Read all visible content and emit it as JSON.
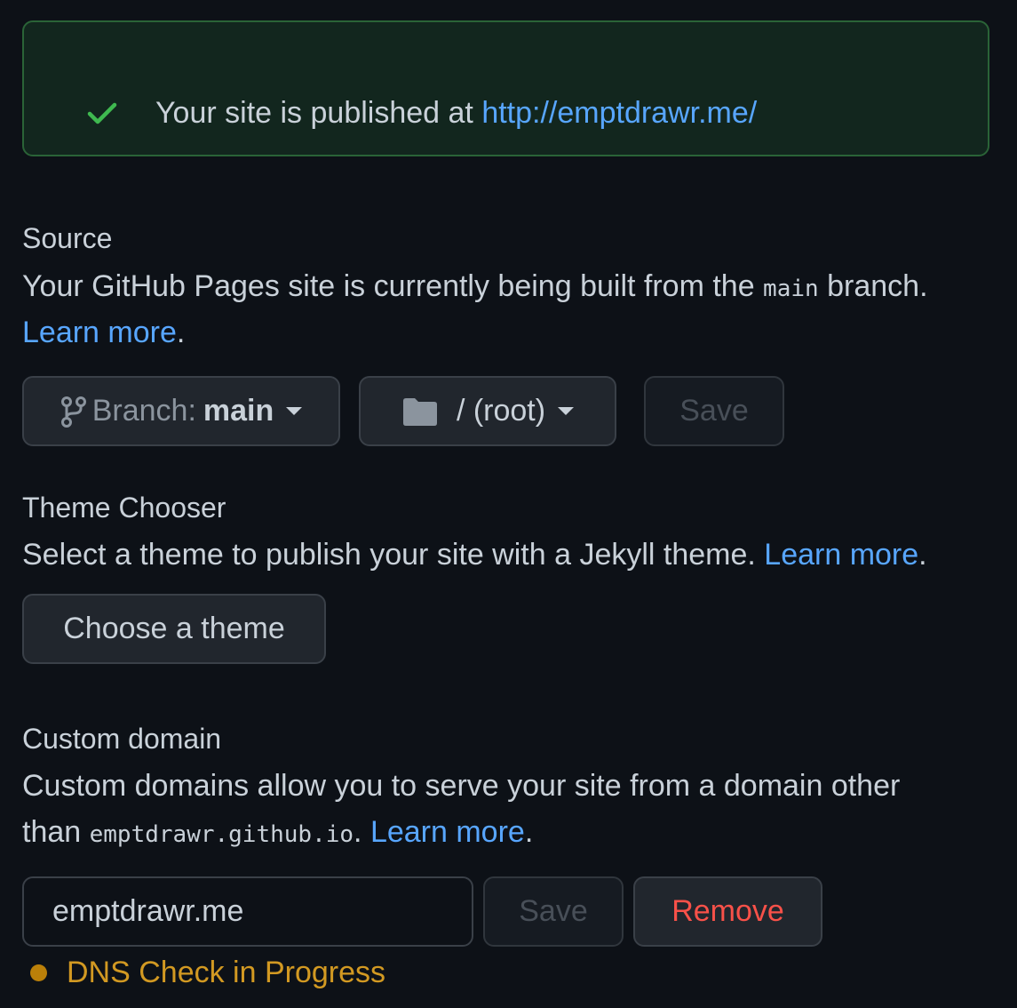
{
  "flash": {
    "icon": "check-icon",
    "message": "Your site is published at ",
    "url": "http://emptdrawr.me/",
    "color_text": "#c9d1d9",
    "color_link": "#58a6ff",
    "color_success": "#3fb950"
  },
  "source": {
    "heading": "Source",
    "desc_before": "Your GitHub Pages site is currently being built from the ",
    "branch_code": "main",
    "desc_after": " branch.",
    "learn_more": "Learn more",
    "period": ".",
    "branch_button": {
      "icon": "git-branch-icon",
      "prefix": "Branch: ",
      "value": "main"
    },
    "folder_button": {
      "icon": "folder-icon",
      "value": "/ (root)"
    },
    "save_label": "Save"
  },
  "theme": {
    "heading": "Theme Chooser",
    "desc": "Select a theme to publish your site with a Jekyll theme. ",
    "learn_more": "Learn more",
    "period": ".",
    "button_label": "Choose a theme"
  },
  "domain": {
    "heading": "Custom domain",
    "desc_line1": "Custom domains allow you to serve your site from a domain other",
    "desc_than": "than ",
    "desc_code": "emptdrawr.github.io",
    "desc_period": ". ",
    "learn_more": "Learn more",
    "period": ".",
    "input_value": "emptdrawr.me",
    "save_label": "Save",
    "remove_label": "Remove",
    "status_text": "DNS Check in Progress",
    "status_color": "#d29922",
    "danger_color": "#f85149"
  }
}
